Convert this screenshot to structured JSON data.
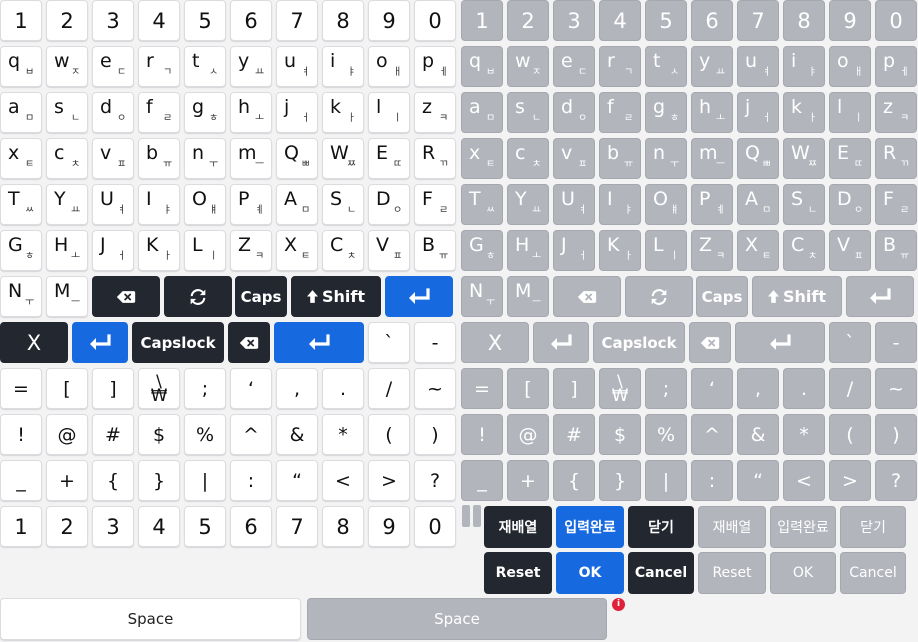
{
  "left_keyboard": {
    "number_row": [
      "1",
      "2",
      "3",
      "4",
      "5",
      "6",
      "7",
      "8",
      "9",
      "0"
    ],
    "row_q": [
      [
        "q",
        "ㅂ"
      ],
      [
        "w",
        "ㅈ"
      ],
      [
        "e",
        "ㄷ"
      ],
      [
        "r",
        "ㄱ"
      ],
      [
        "t",
        "ㅅ"
      ],
      [
        "y",
        "ㅛ"
      ],
      [
        "u",
        "ㅕ"
      ],
      [
        "i",
        "ㅑ"
      ],
      [
        "o",
        "ㅐ"
      ],
      [
        "p",
        "ㅔ"
      ]
    ],
    "row_a": [
      [
        "a",
        "ㅁ"
      ],
      [
        "s",
        "ㄴ"
      ],
      [
        "d",
        "ㅇ"
      ],
      [
        "f",
        "ㄹ"
      ],
      [
        "g",
        "ㅎ"
      ],
      [
        "h",
        "ㅗ"
      ],
      [
        "j",
        "ㅓ"
      ],
      [
        "k",
        "ㅏ"
      ],
      [
        "l",
        "ㅣ"
      ],
      [
        "z",
        "ㅋ"
      ]
    ],
    "row_x": [
      [
        "x",
        "ㅌ"
      ],
      [
        "c",
        "ㅊ"
      ],
      [
        "v",
        "ㅍ"
      ],
      [
        "b",
        "ㅠ"
      ],
      [
        "n",
        "ㅜ"
      ],
      [
        "m",
        "ㅡ"
      ],
      [
        "Q",
        "ㅃ"
      ],
      [
        "W",
        "ㅉ"
      ],
      [
        "E",
        "ㄸ"
      ],
      [
        "R",
        "ㄲ"
      ]
    ],
    "row_T": [
      [
        "T",
        "ㅆ"
      ],
      [
        "Y",
        "ㅛ"
      ],
      [
        "U",
        "ㅕ"
      ],
      [
        "I",
        "ㅑ"
      ],
      [
        "O",
        "ㅒ"
      ],
      [
        "P",
        "ㅖ"
      ],
      [
        "A",
        "ㅁ"
      ],
      [
        "S",
        "ㄴ"
      ],
      [
        "D",
        "ㅇ"
      ],
      [
        "F",
        "ㄹ"
      ]
    ],
    "row_G": [
      [
        "G",
        "ㅎ"
      ],
      [
        "H",
        "ㅗ"
      ],
      [
        "J",
        "ㅓ"
      ],
      [
        "K",
        "ㅏ"
      ],
      [
        "L",
        "ㅣ"
      ],
      [
        "Z",
        "ㅋ"
      ],
      [
        "X",
        "ㅌ"
      ],
      [
        "C",
        "ㅊ"
      ],
      [
        "V",
        "ㅍ"
      ],
      [
        "B",
        "ㅠ"
      ]
    ],
    "row_N": [
      [
        "N",
        "ㅜ"
      ],
      [
        "M",
        "ㅡ"
      ]
    ],
    "caps_label": "Caps",
    "shift_label": "Shift",
    "x_label": "X",
    "capslock_label": "Capslock",
    "row_sym1": [
      "`",
      "-"
    ],
    "row_sym2": [
      "=",
      "[",
      "]",
      "₩",
      ";",
      "‘",
      ",",
      ".",
      "/",
      "~"
    ],
    "row_sym3": [
      "!",
      "@",
      "#",
      "$",
      "%",
      "^",
      "&",
      "*",
      "(",
      ")"
    ],
    "row_sym4": [
      "_",
      "+",
      "{",
      "}",
      "|",
      ":",
      "“",
      "<",
      ">",
      "?"
    ],
    "number_row2": [
      "1",
      "2",
      "3",
      "4",
      "5",
      "6",
      "7",
      "8",
      "9",
      "0"
    ],
    "space_label": "Space"
  },
  "right_keyboard": {
    "number_row": [
      "1",
      "2",
      "3",
      "4",
      "5",
      "6",
      "7",
      "8",
      "9",
      "0"
    ],
    "row_q": [
      [
        "q",
        "ㅂ"
      ],
      [
        "w",
        "ㅈ"
      ],
      [
        "e",
        "ㄷ"
      ],
      [
        "r",
        "ㄱ"
      ],
      [
        "t",
        "ㅅ"
      ],
      [
        "y",
        "ㅛ"
      ],
      [
        "u",
        "ㅕ"
      ],
      [
        "i",
        "ㅑ"
      ],
      [
        "o",
        "ㅐ"
      ],
      [
        "p",
        "ㅔ"
      ]
    ],
    "row_a": [
      [
        "a",
        "ㅁ"
      ],
      [
        "s",
        "ㄴ"
      ],
      [
        "d",
        "ㅇ"
      ],
      [
        "f",
        "ㄹ"
      ],
      [
        "g",
        "ㅎ"
      ],
      [
        "h",
        "ㅗ"
      ],
      [
        "j",
        "ㅓ"
      ],
      [
        "k",
        "ㅏ"
      ],
      [
        "l",
        "ㅣ"
      ],
      [
        "z",
        "ㅋ"
      ]
    ],
    "row_x": [
      [
        "x",
        "ㅌ"
      ],
      [
        "c",
        "ㅊ"
      ],
      [
        "v",
        "ㅍ"
      ],
      [
        "b",
        "ㅠ"
      ],
      [
        "n",
        "ㅜ"
      ],
      [
        "m",
        "ㅡ"
      ],
      [
        "Q",
        "ㅃ"
      ],
      [
        "W",
        "ㅉ"
      ],
      [
        "E",
        "ㄸ"
      ],
      [
        "R",
        "ㄲ"
      ]
    ],
    "row_T": [
      [
        "T",
        "ㅆ"
      ],
      [
        "Y",
        "ㅛ"
      ],
      [
        "U",
        "ㅕ"
      ],
      [
        "I",
        "ㅑ"
      ],
      [
        "O",
        "ㅒ"
      ],
      [
        "P",
        "ㅖ"
      ],
      [
        "A",
        "ㅁ"
      ],
      [
        "S",
        "ㄴ"
      ],
      [
        "D",
        "ㅇ"
      ],
      [
        "F",
        "ㄹ"
      ]
    ],
    "row_G": [
      [
        "G",
        "ㅎ"
      ],
      [
        "H",
        "ㅗ"
      ],
      [
        "J",
        "ㅓ"
      ],
      [
        "K",
        "ㅏ"
      ],
      [
        "L",
        "ㅣ"
      ],
      [
        "Z",
        "ㅋ"
      ],
      [
        "X",
        "ㅌ"
      ],
      [
        "C",
        "ㅊ"
      ],
      [
        "V",
        "ㅍ"
      ],
      [
        "B",
        "ㅠ"
      ]
    ],
    "row_N": [
      [
        "N",
        "ㅜ"
      ],
      [
        "M",
        "ㅡ"
      ]
    ],
    "caps_label": "Caps",
    "shift_label": "Shift",
    "x_label": "X",
    "capslock_label": "Capslock",
    "row_sym1": [
      "`",
      "-"
    ],
    "row_sym2": [
      "=",
      "[",
      "]",
      "₩",
      ";",
      "‘",
      ",",
      ".",
      "/",
      "~"
    ],
    "row_sym3": [
      "!",
      "@",
      "#",
      "$",
      "%",
      "^",
      "&",
      "*",
      "(",
      ")"
    ],
    "row_sym4": [
      "_",
      "+",
      "{",
      "}",
      "|",
      ":",
      "“",
      "<",
      ">",
      "?"
    ],
    "space_label": "Space"
  },
  "action_panel": {
    "active": [
      "재배열",
      "입력완료",
      "닫기",
      "Reset",
      "OK",
      "Cancel"
    ],
    "disabled": [
      "재배열",
      "입력완료",
      "닫기",
      "Reset",
      "OK",
      "Cancel"
    ]
  },
  "badge": "i",
  "colors": {
    "white_key": "#ffffff",
    "gray_key": "#b3b5bd",
    "dark_key": "#23272f",
    "blue_key": "#1769e0",
    "badge": "#e0213a"
  }
}
